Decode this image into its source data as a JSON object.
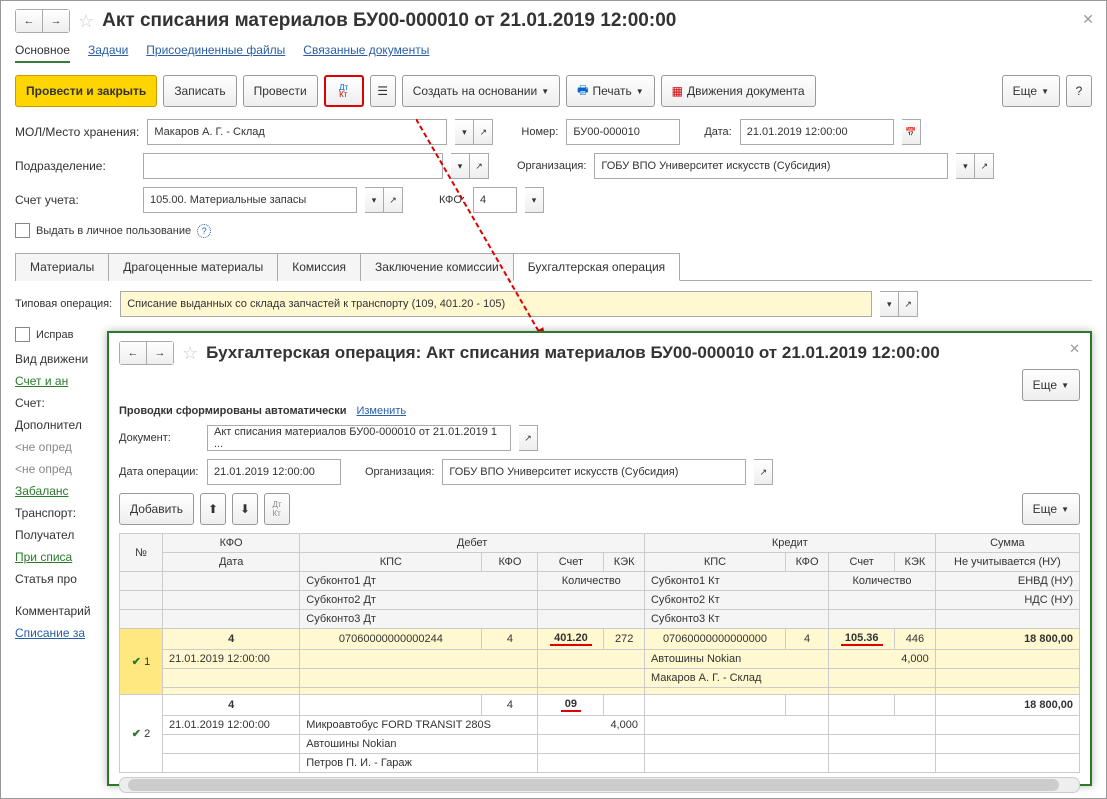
{
  "main": {
    "title": "Акт списания материалов БУ00-000010 от 21.01.2019 12:00:00",
    "tabs": {
      "active": "Основное",
      "t1": "Задачи",
      "t2": "Присоединенные файлы",
      "t3": "Связанные документы"
    },
    "toolbar": {
      "primary": "Провести и закрыть",
      "save": "Записать",
      "post": "Провести",
      "create": "Создать на основании",
      "print": "Печать",
      "moves": "Движения документа",
      "more": "Еще",
      "help": "?"
    },
    "fields": {
      "mol_label": "МОЛ/Место хранения:",
      "mol": "Макаров А. Г. - Склад",
      "num_label": "Номер:",
      "num": "БУ00-000010",
      "date_label": "Дата:",
      "date": "21.01.2019 12:00:00",
      "dept_label": "Подразделение:",
      "dept": "",
      "org_label": "Организация:",
      "org": "ГОБУ ВПО Университет искусств (Субсидия)",
      "acc_label": "Счет учета:",
      "acc": "105.00. Материальные запасы",
      "kfo_label": "КФО:",
      "kfo": "4",
      "personal": "Выдать в личное пользование"
    },
    "subtabs": {
      "t1": "Материалы",
      "t2": "Драгоценные материалы",
      "t3": "Комиссия",
      "t4": "Заключение комиссии",
      "t5": "Бухгалтерская операция"
    },
    "typ_label": "Типовая операция:",
    "typ": "Списание выданных со склада запчастей к транспорту (109, 401.20 - 105)",
    "corr": "Исправ",
    "vid": "Вид движени",
    "schet_an": "Счет и ан",
    "schet": "Счет:",
    "dopoln": "Дополнител",
    "undef": "<не опред",
    "zabalan": "Забаланс",
    "transp": "Транспорт:",
    "poluch": "Получател",
    "pri": "При списа",
    "stat": "Статья про",
    "komm": "Комментарий",
    "spis": "Списание за"
  },
  "sub": {
    "title": "Бухгалтерская операция: Акт списания материалов БУ00-000010 от 21.01.2019 12:00:00",
    "auto": "Проводки сформированы автоматически",
    "change": "Изменить",
    "doc_label": "Документ:",
    "doc": "Акт списания материалов БУ00-000010 от 21.01.2019 1 ...",
    "opdate_label": "Дата операции:",
    "opdate": "21.01.2019 12:00:00",
    "org_label": "Организация:",
    "org": "ГОБУ ВПО Университет искусств (Субсидия)",
    "add": "Добавить",
    "more": "Еще",
    "head": {
      "n": "№",
      "kfo": "КФО",
      "debit": "Дебет",
      "credit": "Кредит",
      "sum": "Сумма",
      "date": "Дата",
      "kps": "КПС",
      "acc": "Счет",
      "kek": "КЭК",
      "neuch": "Не учитывается (НУ)",
      "qty": "Количество",
      "envd": "ЕНВД (НУ)",
      "nds": "НДС (НУ)",
      "s1d": "Субконто1 Дт",
      "s2d": "Субконто2 Дт",
      "s3d": "Субконто3 Дт",
      "s1k": "Субконто1 Кт",
      "s2k": "Субконто2 Кт",
      "s3k": "Субконто3 Кт"
    },
    "r1": {
      "n": "1",
      "kfo": "4",
      "date": "21.01.2019 12:00:00",
      "kps_d": "07060000000000244",
      "kfo_d": "4",
      "acc_d": "401.20",
      "kek_d": "272",
      "kps_k": "07060000000000000",
      "kfo_k": "4",
      "acc_k": "105.36",
      "kek_k": "446",
      "sum": "18 800,00",
      "qty_k": "4,000",
      "sk1": "Автошины Nokian",
      "sk2": "Макаров А. Г. - Склад"
    },
    "r2": {
      "n": "2",
      "kfo": "4",
      "date": "21.01.2019 12:00:00",
      "kfo_d": "4",
      "acc_d": "09",
      "qty_d": "4,000",
      "sum": "18 800,00",
      "sd1": "Микроавтобус FORD TRANSIT 280S",
      "sd2": "Автошины Nokian",
      "sd3": "Петров П. И. - Гараж"
    }
  }
}
